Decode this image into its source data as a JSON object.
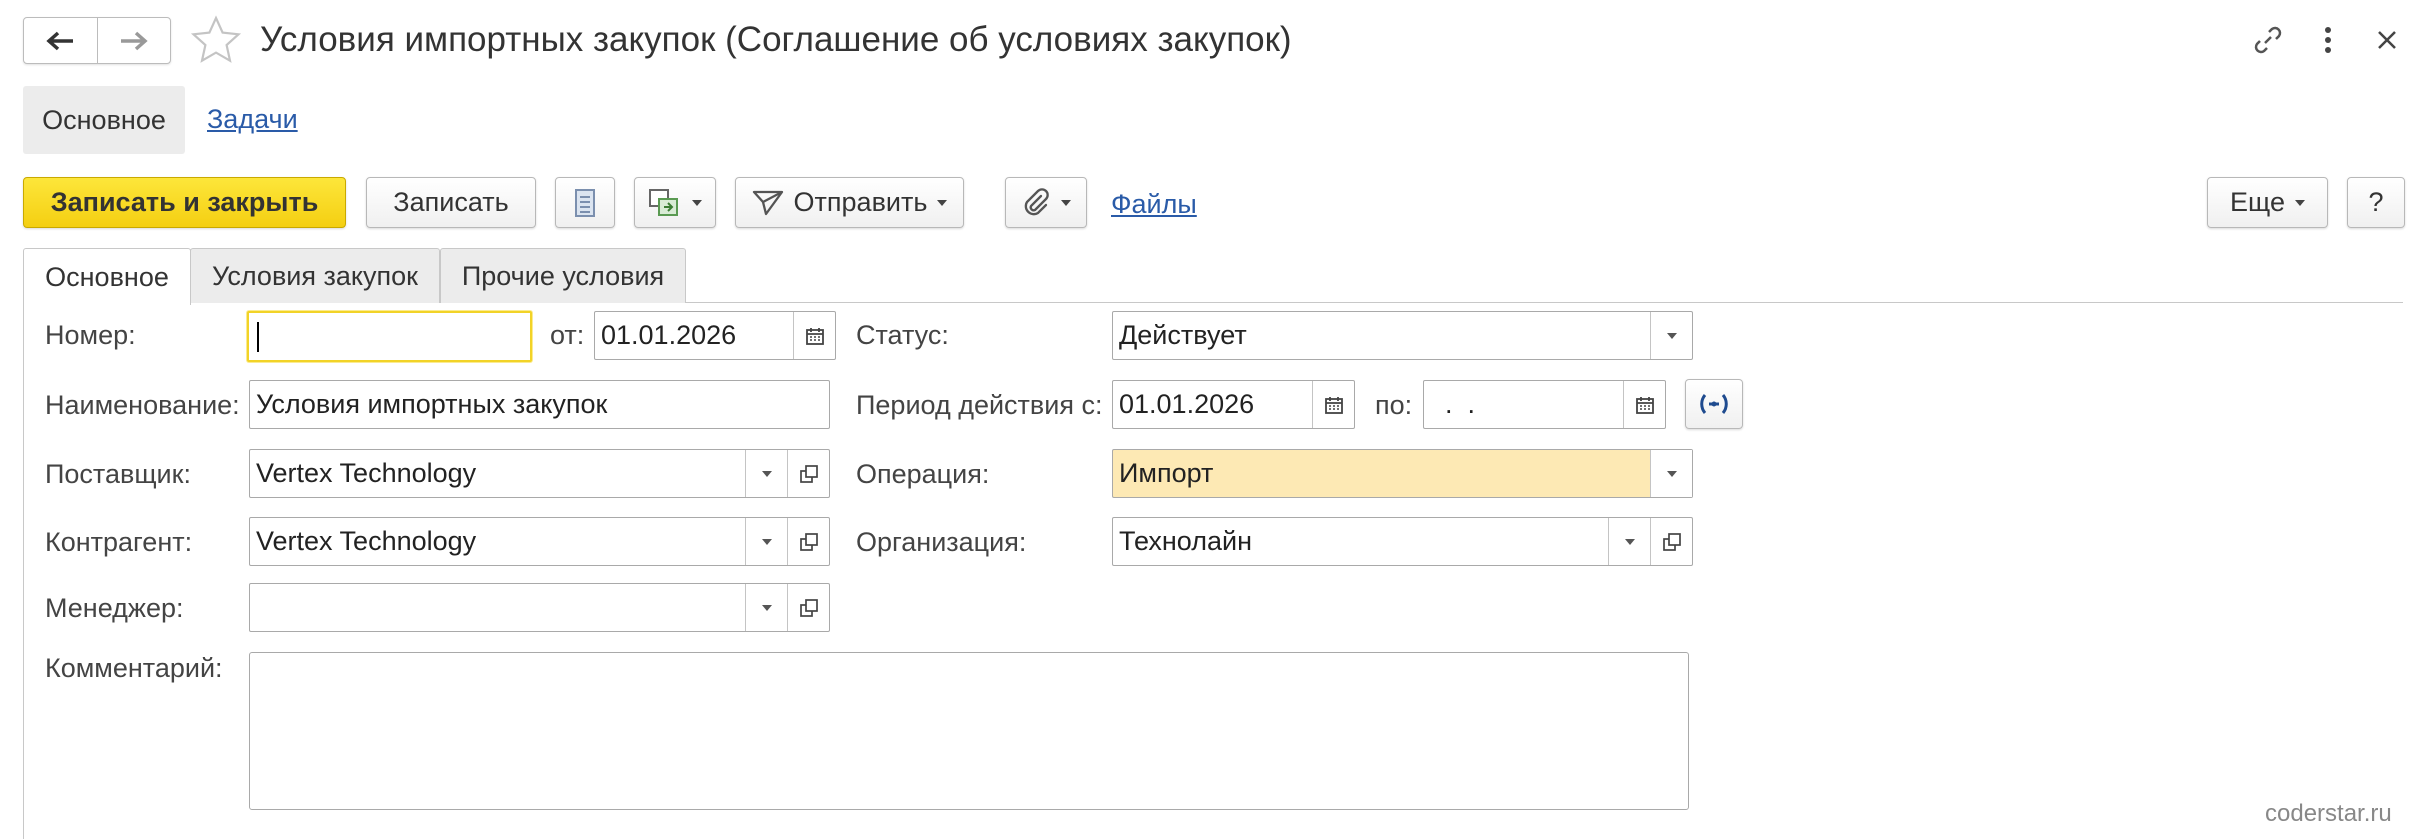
{
  "window": {
    "title": "Условия импортных закупок (Соглашение об условиях закупок)"
  },
  "sections": {
    "active": "Основное",
    "link": "Задачи"
  },
  "toolbar": {
    "save_close": "Записать и закрыть",
    "save": "Записать",
    "send": "Отправить",
    "files": "Файлы",
    "more": "Еще",
    "help": "?"
  },
  "tabs": {
    "main": "Основное",
    "conditions": "Условия закупок",
    "other": "Прочие условия"
  },
  "form": {
    "number_label": "Номер:",
    "number_value": "",
    "from_label": "от:",
    "from_value": "01.01.2026",
    "name_label": "Наименование:",
    "name_value": "Условия импортных закупок",
    "supplier_label": "Поставщик:",
    "supplier_value": "Vertex Technology",
    "counterparty_label": "Контрагент:",
    "counterparty_value": "Vertex Technology",
    "manager_label": "Менеджер:",
    "manager_value": "",
    "comment_label": "Комментарий:",
    "status_label": "Статус:",
    "status_value": "Действует",
    "period_label": "Период действия с:",
    "period_from_value": "01.01.2026",
    "period_to_label": "по:",
    "period_to_value": "  .  .",
    "operation_label": "Операция:",
    "operation_value": "Импорт",
    "organization_label": "Организация:",
    "organization_value": "Технолайн"
  },
  "watermark": "coderstar.ru",
  "colors": {
    "primary_button": "#f4cf12",
    "link": "#2a5ba8",
    "highlight_field": "#fde9b4",
    "focus_border": "#f2d327"
  }
}
